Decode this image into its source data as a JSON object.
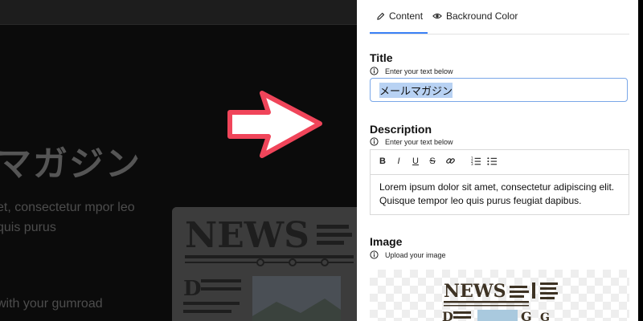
{
  "preview": {
    "title": "マガジン",
    "description": "et, consectetur mpor leo quis purus",
    "cta": "with your gumroad"
  },
  "tabs": [
    {
      "label": "Content",
      "icon": "pencil-icon",
      "active": true
    },
    {
      "label": "Backround Color",
      "icon": "eye-icon",
      "active": false
    }
  ],
  "title_section": {
    "heading": "Title",
    "hint": "Enter your text below",
    "value": "メールマガジン"
  },
  "description_section": {
    "heading": "Description",
    "hint": "Enter your text below",
    "toolbar": {
      "bold": "B",
      "italic": "I",
      "underline": "U",
      "strike": "S"
    },
    "text": "Lorem ipsum dolor sit amet, consectetur adipiscing elit. Quisque tempor leo quis purus feugiat dapibus."
  },
  "image_section": {
    "heading": "Image",
    "hint": "Upload your image"
  },
  "colors": {
    "accent": "#3b82f6",
    "arrow_fill": "#ffffff",
    "arrow_stroke": "#f0455a"
  }
}
